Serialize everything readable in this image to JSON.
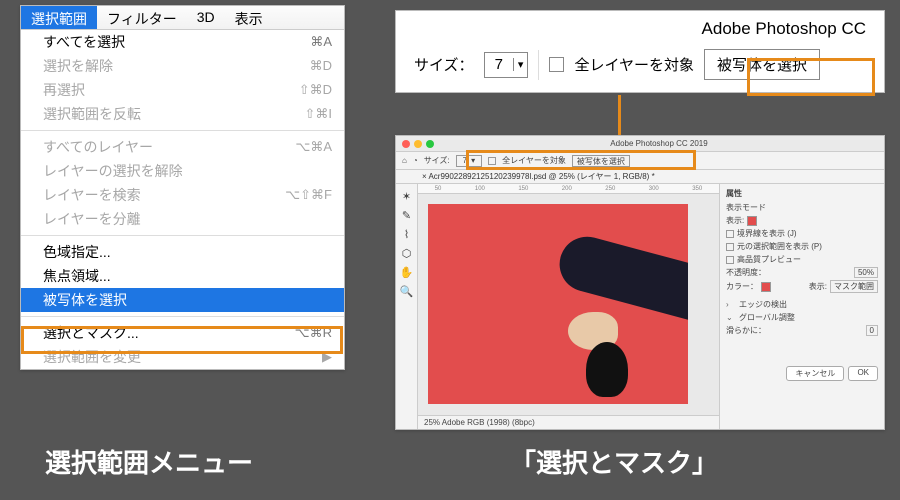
{
  "caption_left": "選択範囲メニュー",
  "caption_right": "「選択とマスク」",
  "menubar": {
    "items": [
      "選択範囲",
      "フィルター",
      "3D",
      "表示"
    ],
    "active_index": 0
  },
  "menu": {
    "group1": [
      {
        "label": "すべてを選択",
        "shortcut": "⌘A",
        "disabled": false
      },
      {
        "label": "選択を解除",
        "shortcut": "⌘D",
        "disabled": true
      },
      {
        "label": "再選択",
        "shortcut": "⇧⌘D",
        "disabled": true
      },
      {
        "label": "選択範囲を反転",
        "shortcut": "⇧⌘I",
        "disabled": true
      }
    ],
    "group2": [
      {
        "label": "すべてのレイヤー",
        "shortcut": "⌥⌘A",
        "disabled": true
      },
      {
        "label": "レイヤーの選択を解除",
        "shortcut": "",
        "disabled": true
      },
      {
        "label": "レイヤーを検索",
        "shortcut": "⌥⇧⌘F",
        "disabled": true
      },
      {
        "label": "レイヤーを分離",
        "shortcut": "",
        "disabled": true
      }
    ],
    "group3": [
      {
        "label": "色域指定...",
        "shortcut": "",
        "disabled": false
      },
      {
        "label": "焦点領域...",
        "shortcut": "",
        "disabled": false
      },
      {
        "label": "被写体を選択",
        "shortcut": "",
        "disabled": false,
        "selected": true
      }
    ],
    "group4": [
      {
        "label": "選択とマスク...",
        "shortcut": "⌥⌘R",
        "disabled": false
      },
      {
        "label": "選択範囲を変更",
        "shortcut": "▶",
        "disabled": true
      }
    ]
  },
  "zoom_panel": {
    "app_title": "Adobe Photoshop CC",
    "size_label": "サイズ：",
    "size_value": "7",
    "all_layers_label": "全レイヤーを対象",
    "select_subject_label": "被写体を選択"
  },
  "ps_window": {
    "title": "Adobe Photoshop CC 2019",
    "toolbar": {
      "size_label": "サイズ:",
      "size_value": "7",
      "all_layers": "全レイヤーを対象",
      "select_subject": "被写体を選択"
    },
    "tabbar": "× Acr99022892125120239978l.psd @ 25% (レイヤー 1, RGB/8) *",
    "ruler_marks": [
      "50",
      "100",
      "150",
      "200",
      "250",
      "300",
      "350"
    ],
    "status": "25%      Adobe RGB (1998) (8bpc)",
    "props": {
      "title": "属性",
      "mode_label": "表示モード",
      "show_label": "表示:",
      "edge_show": "境界線を表示 (J)",
      "orig_show": "元の選択範囲を表示 (P)",
      "hq_preview": "高品質プレビュー",
      "opacity_label": "不透明度：",
      "opacity_value": "50%",
      "color_label": "カラー：",
      "indicate_label": "表示:",
      "indicate_value": "マスク範囲",
      "edge_detect": "エッジの検出",
      "global_adjust": "グローバル調整",
      "smooth_label": "滑らかに：",
      "smooth_value": "0",
      "cancel": "キャンセル",
      "ok": "OK"
    }
  }
}
